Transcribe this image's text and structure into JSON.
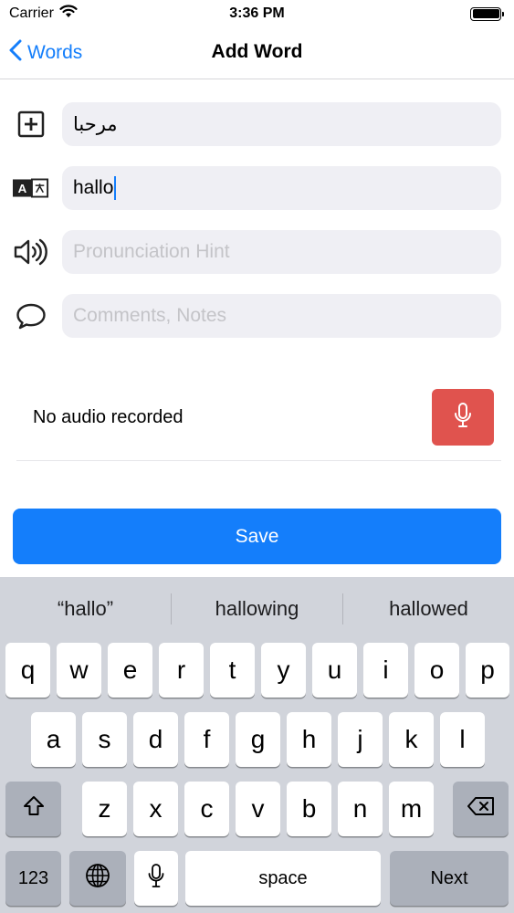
{
  "status_bar": {
    "carrier": "Carrier",
    "time": "3:36 PM"
  },
  "nav": {
    "back_label": "Words",
    "title": "Add Word"
  },
  "form": {
    "word_value": "مرحبا",
    "translation_value": "hallo",
    "pronunciation_placeholder": "Pronunciation Hint",
    "comments_placeholder": "Comments, Notes"
  },
  "audio": {
    "status": "No audio recorded"
  },
  "save_label": "Save",
  "keyboard": {
    "suggestions": [
      "“hallo”",
      "hallowing",
      "hallowed"
    ],
    "row1": [
      "q",
      "w",
      "e",
      "r",
      "t",
      "y",
      "u",
      "i",
      "o",
      "p"
    ],
    "row2": [
      "a",
      "s",
      "d",
      "f",
      "g",
      "h",
      "j",
      "k",
      "l"
    ],
    "row3": [
      "z",
      "x",
      "c",
      "v",
      "b",
      "n",
      "m"
    ],
    "numbers_label": "123",
    "space_label": "space",
    "next_label": "Next"
  },
  "colors": {
    "accent": "#147efb",
    "record": "#e0534e",
    "field_bg": "#efeff4",
    "keyboard_bg": "#d1d4db"
  }
}
